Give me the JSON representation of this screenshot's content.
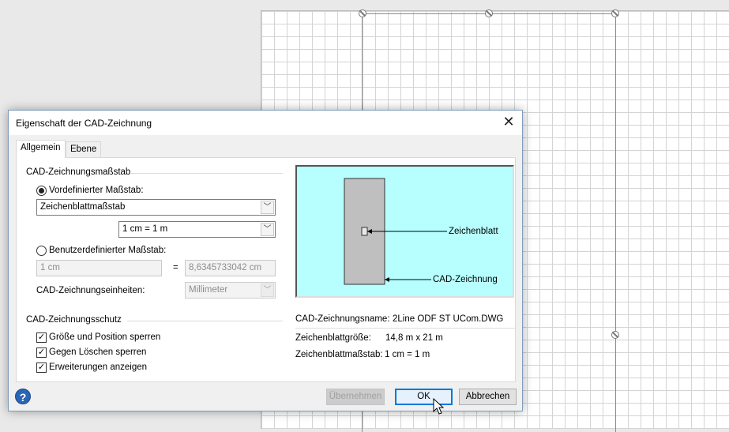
{
  "dialog": {
    "title": "Eigenschaft der CAD-Zeichnung",
    "tabs": [
      {
        "label": "Allgemein",
        "active": true
      },
      {
        "label": "Ebene",
        "active": false
      }
    ],
    "scale_group": {
      "title": "CAD-Zeichnungsmaßstab",
      "predefined_label": "Vordefinierter Maßstab:",
      "predefined_selected": true,
      "predefined_type_value": "Zeichenblattmaßstab",
      "predefined_scale_value": "1 cm = 1 m",
      "custom_label": "Benutzerdefinierter Maßstab:",
      "custom_selected": false,
      "custom_left_value": "1 cm",
      "equals_sign": "=",
      "custom_right_value": "8,6345733042 cm",
      "units_label": "CAD-Zeichnungseinheiten:",
      "units_value": "Millimeter"
    },
    "protection_group": {
      "title": "CAD-Zeichnungsschutz",
      "items": [
        {
          "label": "Größe und Position sperren",
          "checked": true
        },
        {
          "label": "Gegen Löschen sperren",
          "checked": true
        },
        {
          "label": "Erweiterungen anzeigen",
          "checked": true
        }
      ]
    },
    "preview": {
      "page_label": "Zeichenblatt",
      "drawing_label": "CAD-Zeichnung",
      "background_color": "#b7ffff"
    },
    "info": {
      "name_label": "CAD-Zeichnungsname:",
      "name_value": "2Line ODF ST UCom.DWG",
      "size_label": "Zeichenblattgröße:",
      "size_value": "14,8 m x 21 m",
      "scale_label": "Zeichenblattmaßstab:",
      "scale_value": "1 cm = 1 m"
    },
    "buttons": {
      "apply": "Übernehmen",
      "ok": "OK",
      "cancel": "Abbrechen"
    },
    "icons": {
      "close": "close-icon",
      "help": "help-icon",
      "dropdown": "chevron-down-icon"
    }
  }
}
